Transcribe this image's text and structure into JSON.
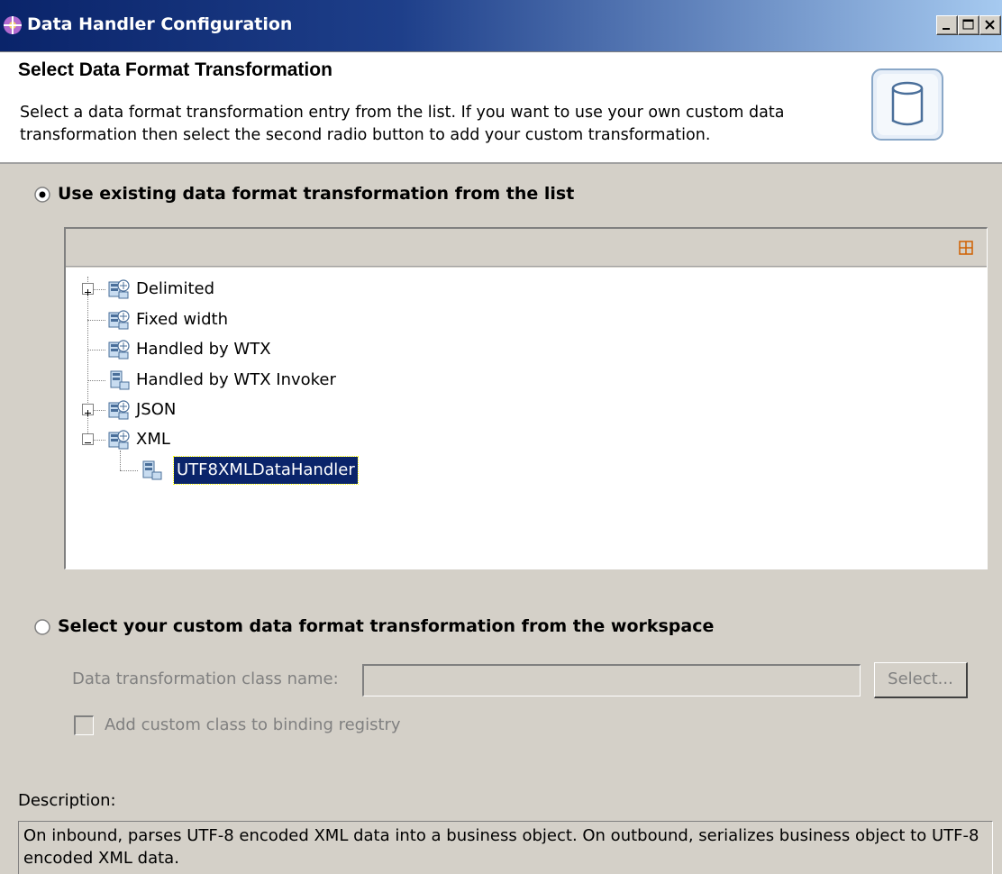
{
  "window": {
    "title": "Data Handler Configuration"
  },
  "header": {
    "title": "Select Data Format Transformation",
    "description": "Select a data format transformation entry from the list.  If you want to use your own custom data transformation then select the second radio button to add your custom transformation."
  },
  "option_existing": {
    "label": "Use existing data format transformation from the list",
    "selected": true
  },
  "tree": {
    "items": [
      {
        "label": "Delimited",
        "expandable": true,
        "expanded": false,
        "level": 0
      },
      {
        "label": "Fixed width",
        "expandable": false,
        "level": 0
      },
      {
        "label": "Handled by WTX",
        "expandable": false,
        "level": 0
      },
      {
        "label": "Handled by WTX Invoker",
        "expandable": false,
        "level": 0
      },
      {
        "label": "JSON",
        "expandable": true,
        "expanded": false,
        "level": 0
      },
      {
        "label": "XML",
        "expandable": true,
        "expanded": true,
        "level": 0
      },
      {
        "label": "UTF8XMLDataHandler",
        "expandable": false,
        "level": 1,
        "selected": true
      }
    ]
  },
  "option_custom": {
    "label": "Select your custom data format transformation from the workspace",
    "selected": false,
    "class_name_label": "Data transformation class name:",
    "class_name_value": "",
    "select_button": "Select...",
    "checkbox_label": "Add custom class to binding registry",
    "checkbox_checked": false
  },
  "description": {
    "label": "Description:",
    "text": "On inbound, parses UTF-8 encoded XML data into a business object. On outbound, serializes business object to UTF-8 encoded XML data."
  },
  "colors": {
    "titlebar": "#0a246a",
    "selection": "#0a246a",
    "dialog_bg": "#d4d0c8",
    "disabled_text": "#808080"
  }
}
